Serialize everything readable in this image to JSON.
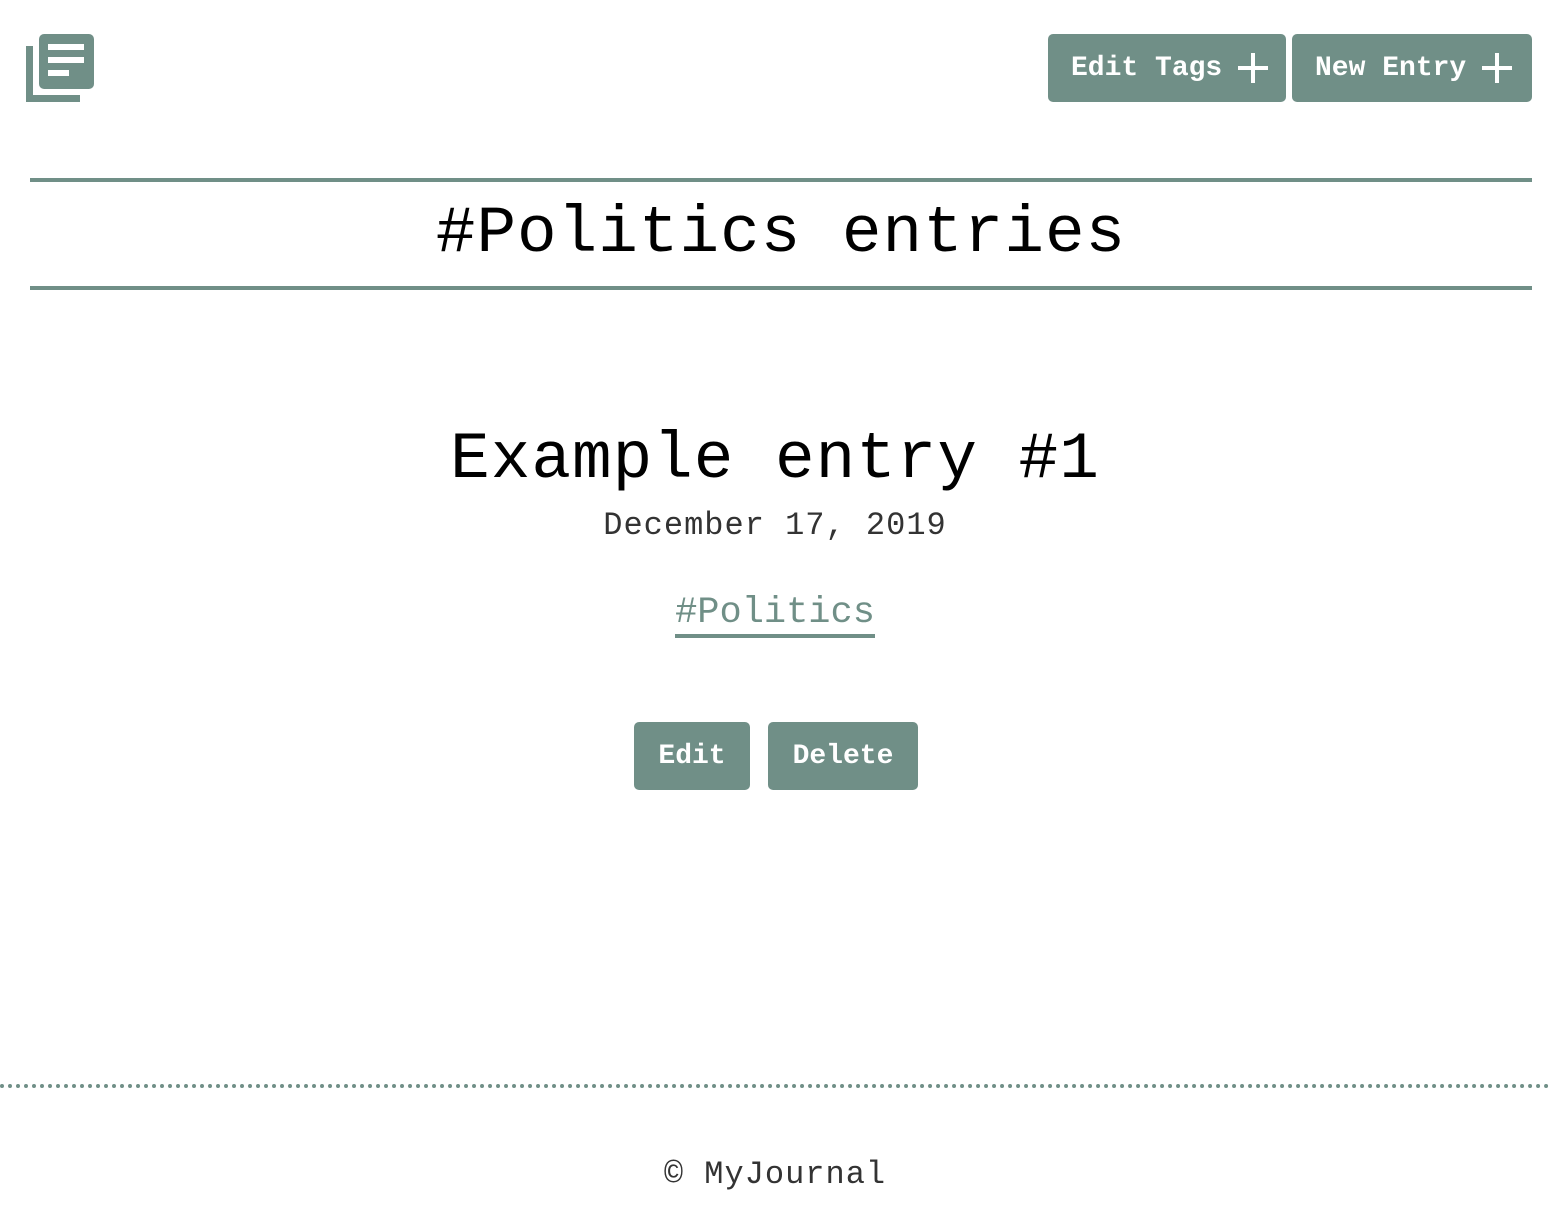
{
  "header": {
    "logo_icon": "journal-stack-icon",
    "edit_tags_label": "Edit Tags",
    "new_entry_label": "New Entry",
    "button_icon": "plus-icon"
  },
  "page": {
    "title": "#Politics entries"
  },
  "entry": {
    "title": "Example entry #1",
    "date": "December 17, 2019",
    "tag": "#Politics",
    "edit_label": "Edit",
    "delete_label": "Delete"
  },
  "footer": {
    "text": "© MyJournal"
  },
  "colors": {
    "accent": "#708f87",
    "text": "#000000",
    "muted_text": "#333333",
    "background": "#ffffff"
  }
}
